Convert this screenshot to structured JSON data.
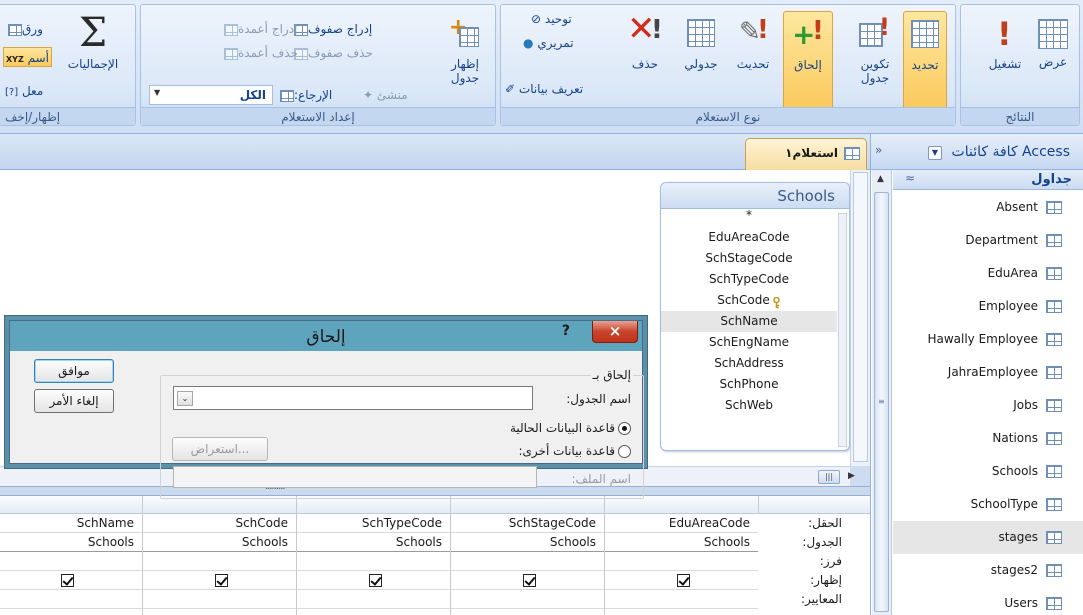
{
  "ribbon": {
    "results": {
      "label": "النتائج",
      "view_label": "عرض",
      "run_label": "تشغيل"
    },
    "query_type": {
      "label": "نوع الاستعلام",
      "select_label": "تحديد",
      "make_table_label": "تكوين جدول",
      "append_label": "إلحاق",
      "update_label": "تحديث",
      "crosstab_label": "جدولي",
      "delete_label": "حذف",
      "union_label": "توحيد",
      "passthrough_label": "تمريري",
      "data_definition_label": "تعريف بيانات"
    },
    "query_setup": {
      "label": "إعداد الاستعلام",
      "show_table_label": "إظهار جدول",
      "insert_rows_label": "إدراج صفوف",
      "insert_columns_label": "إدراج أعمدة",
      "delete_rows_label": "حذف صفوف",
      "delete_columns_label": "حذف أعمدة",
      "builder_label": "منشئ",
      "return_label": "الإرجاع:",
      "return_value": "الكل"
    },
    "show_hide": {
      "label": "إظهار/إخف",
      "totals_label": "الإجماليات",
      "sheet_label": "ورق",
      "names_label": "أسم",
      "params_label": "معل"
    }
  },
  "nav": {
    "title": "كافة كائنات Access",
    "section_title": "جداول",
    "items": [
      {
        "name": "Absent"
      },
      {
        "name": "Department"
      },
      {
        "name": "EduArea"
      },
      {
        "name": "Employee"
      },
      {
        "name": "Hawally Employee"
      },
      {
        "name": "JahraEmployee"
      },
      {
        "name": "Jobs"
      },
      {
        "name": "Nations"
      },
      {
        "name": "Schools"
      },
      {
        "name": "SchoolType"
      },
      {
        "name": "stages"
      },
      {
        "name": "stages2"
      },
      {
        "name": "Users"
      }
    ]
  },
  "tab": {
    "title": "استعلام١"
  },
  "table_box": {
    "title": "Schools",
    "fields": [
      "*",
      "EduAreaCode",
      "SchStageCode",
      "SchTypeCode",
      "SchCode",
      "SchName",
      "SchEngName",
      "SchAddress",
      "SchPhone",
      "SchWeb"
    ]
  },
  "qbe": {
    "row_labels": [
      "الحقل:",
      "الجدول:",
      "فرز:",
      "إظهار:",
      "المعايير:"
    ],
    "columns": [
      {
        "field": "EduAreaCode",
        "table": "Schools"
      },
      {
        "field": "SchStageCode",
        "table": "Schools"
      },
      {
        "field": "SchTypeCode",
        "table": "Schools"
      },
      {
        "field": "SchCode",
        "table": "Schools"
      },
      {
        "field": "SchName",
        "table": "Schools"
      }
    ]
  },
  "dialog": {
    "title": "إلحاق",
    "help": "?",
    "close": "×",
    "group_label": "إلحاق بـ",
    "table_name_label": "اسم الجدول:",
    "table_name_value": "",
    "current_db_label": "قاعدة البيانات الحالية",
    "other_db_label": "قاعدة بيانات أخرى:",
    "file_name_label": "اسم الملف:",
    "file_name_value": "",
    "browse_label": "استعراض...",
    "ok_label": "موافق",
    "cancel_label": "إلغاء الأمر"
  }
}
